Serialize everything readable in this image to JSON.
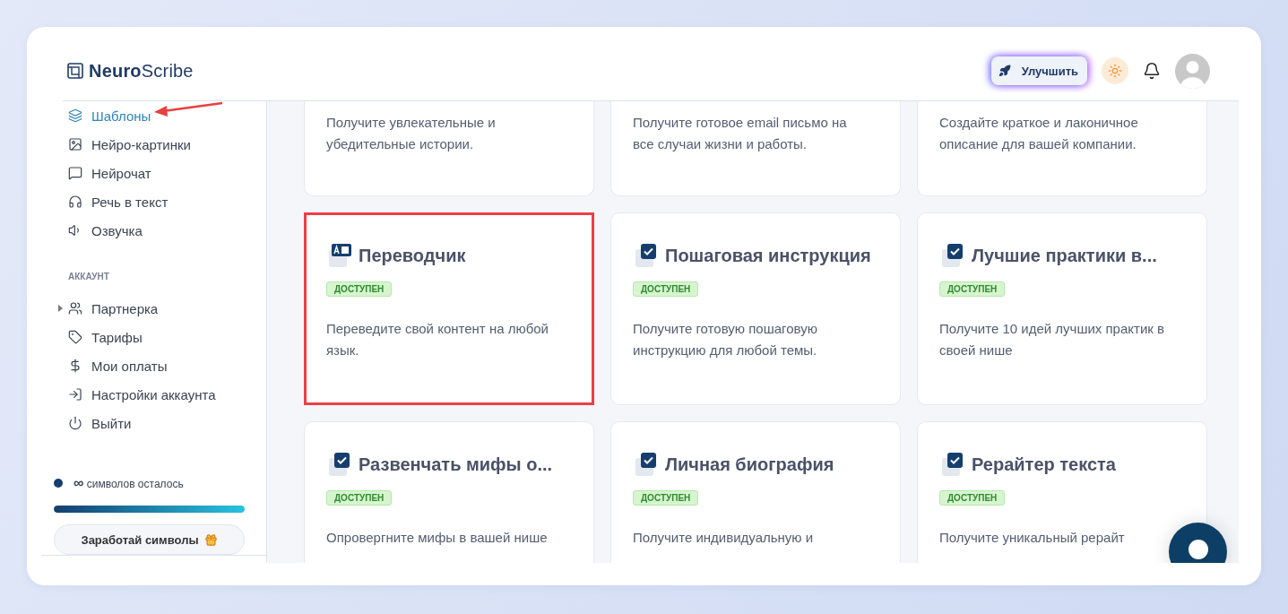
{
  "logo": "**Neuro**Scribe",
  "header": {
    "upgrade": "Улучшить",
    "theme_toggle": {
      "on": false
    }
  },
  "sidebar": {
    "items": [
      {
        "label": "Шаблоны",
        "selected": true
      },
      {
        "label": "Нейро-картинки",
        "selected": false
      },
      {
        "label": "Нейрочат",
        "selected": false
      },
      {
        "label": "Речь в текст",
        "selected": false
      },
      {
        "label": "Озвучка",
        "selected": false
      }
    ],
    "section": "АККАУНТ",
    "account_items": [
      {
        "label": "Партнерка",
        "expanded": false
      },
      {
        "label": "Тарифы"
      },
      {
        "label": "Мои оплаты"
      },
      {
        "label": "Настройки аккаунта"
      },
      {
        "label": "Выйти"
      }
    ],
    "credits": {
      "symbol": "∞",
      "label": "символов осталось",
      "level": 1
    },
    "earn_button": "Заработай символы"
  },
  "cards": [
    {
      "description": "Получите увлекательные и убедительные истории.",
      "highlighted": false
    },
    {
      "description": "Получите готовое email письмо на все случаи жизни и работы.",
      "highlighted": false
    },
    {
      "description": "Создайте краткое и лаконичное описание для вашей компании.",
      "highlighted": false
    },
    {
      "title": "Переводчик",
      "badge": "ДОСТУПЕН",
      "description": "Переведите свой контент на любой язык.",
      "highlighted": true
    },
    {
      "title": "Пошаговая инструкция",
      "badge": "ДОСТУПЕН",
      "description": "Получите готовую пошаговую инструкцию для любой темы.",
      "highlighted": false
    },
    {
      "title": "Лучшие практики в...",
      "badge": "ДОСТУПЕН",
      "description": "Получите 10 идей лучших практик в своей нише",
      "highlighted": false
    },
    {
      "title": "Развенчать мифы о...",
      "badge": "ДОСТУПЕН",
      "description": "Опровергните мифы в вашей нише",
      "highlighted": false
    },
    {
      "title": "Личная биография",
      "badge": "ДОСТУПЕН",
      "description": "Получите индивидуальную и",
      "highlighted": false
    },
    {
      "title": "Рерайтер текста",
      "badge": "ДОСТУПЕН",
      "description": "Получите уникальный рерайт",
      "highlighted": false
    }
  ]
}
